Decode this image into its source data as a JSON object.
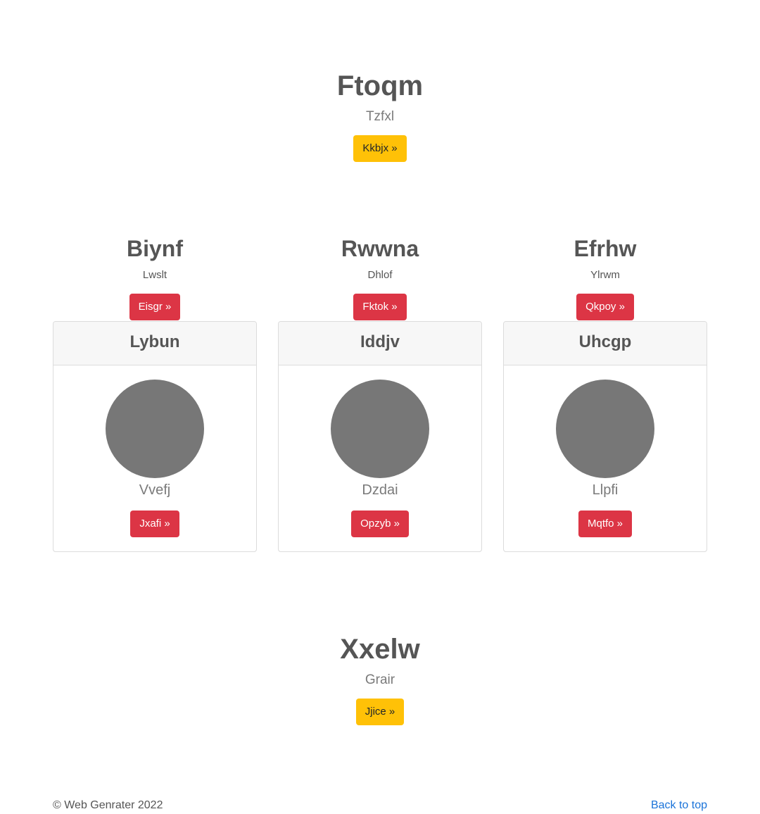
{
  "hero_top": {
    "title": "Ftoqm",
    "lead": "Tzfxl",
    "button": "Kkbjx »"
  },
  "columns": [
    {
      "title": "Biynf",
      "subtitle": "Lwslt",
      "button": "Eisgr »",
      "card": {
        "header": "Lybun",
        "name": "Vvefj",
        "button": "Jxafi »"
      }
    },
    {
      "title": "Rwwna",
      "subtitle": "Dhlof",
      "button": "Fktok »",
      "card": {
        "header": "Iddjv",
        "name": "Dzdai",
        "button": "Opzyb »"
      }
    },
    {
      "title": "Efrhw",
      "subtitle": "Ylrwm",
      "button": "Qkpoy »",
      "card": {
        "header": "Uhcgp",
        "name": "Llpfi",
        "button": "Mqtfo »"
      }
    }
  ],
  "hero_bottom": {
    "title": "Xxelw",
    "lead": "Grair",
    "button": "Jjice »"
  },
  "footer": {
    "copyright": "© Web Genrater 2022",
    "back_to_top": "Back to top"
  },
  "colors": {
    "warning": "#ffc107",
    "danger": "#dc3545",
    "avatar": "#777777",
    "link": "#1a73d9"
  }
}
